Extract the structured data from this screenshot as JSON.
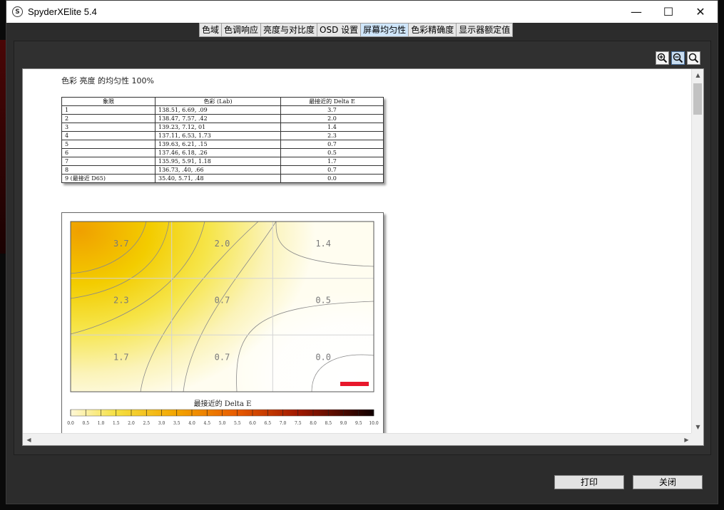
{
  "window": {
    "title": "SpyderXElite 5.4",
    "logo_glyph": "S",
    "minimize_glyph": "—",
    "maximize_glyph": "☐",
    "close_glyph": "✕"
  },
  "tabs": [
    {
      "label": "色域",
      "active": false
    },
    {
      "label": "色调响应",
      "active": false
    },
    {
      "label": "亮度与对比度",
      "active": false
    },
    {
      "label": "OSD 设置",
      "active": false
    },
    {
      "label": "屏幕均匀性",
      "active": true
    },
    {
      "label": "色彩精确度",
      "active": false
    },
    {
      "label": "显示器额定值",
      "active": false
    }
  ],
  "zoom_icons": [
    "zoom-in-icon",
    "zoom-out-icon",
    "zoom-fit-icon"
  ],
  "report": {
    "title": "色彩 亮度 的均匀性 100%",
    "table": {
      "headers": [
        "象限",
        "色彩 (Lab)",
        "最接近的 Delta E"
      ],
      "rows": [
        {
          "quadrant": "1",
          "lab": "138.51,    6.69,    .09",
          "de": "3.7"
        },
        {
          "quadrant": "2",
          "lab": "138.47,    7.57,    .42",
          "de": "2.0"
        },
        {
          "quadrant": "3",
          "lab": "139.23,    7.12,     01",
          "de": "1.4"
        },
        {
          "quadrant": "4",
          "lab": "137.11,    6.53,   1.73",
          "de": "2.3"
        },
        {
          "quadrant": "5",
          "lab": "139.63,    6.21,    .15",
          "de": "0.7"
        },
        {
          "quadrant": "6",
          "lab": "137.46,    6.18,    .26",
          "de": "0.5"
        },
        {
          "quadrant": "7",
          "lab": "135.95,    5.91,   1.18",
          "de": "1.7"
        },
        {
          "quadrant": "8",
          "lab": "136.73,     .40,    .66",
          "de": "0.7"
        },
        {
          "quadrant": "9 (最接近 D65)",
          "lab": "35.40,    5.71,    .48",
          "de": "0.0"
        }
      ]
    },
    "heatmap": {
      "cell_labels": [
        [
          "3.7",
          "2.0",
          "1.4"
        ],
        [
          "2.3",
          "0.7",
          "0.5"
        ],
        [
          "1.7",
          "0.7",
          "0.0"
        ]
      ],
      "legend_title": "最接近的 Delta E",
      "scale_ticks": [
        "0.0",
        "0.5",
        "1.0",
        "1.5",
        "2.0",
        "2.5",
        "3.0",
        "3.5",
        "4.0",
        "4.5",
        "5.0",
        "5.5",
        "6.0",
        "6.5",
        "7.0",
        "7.5",
        "8.0",
        "8.5",
        "9.0",
        "9.5",
        "10.0"
      ],
      "colors": {
        "low": "#fff6cc",
        "mid": "#f2d400",
        "high": "#f0a300",
        "max": "#1a0000",
        "marker": "#e8172b"
      }
    }
  },
  "buttons": {
    "print": "打印",
    "close": "关闭"
  },
  "chart_data": {
    "type": "heatmap",
    "grid": [
      [
        3.7,
        2.0,
        1.4
      ],
      [
        2.3,
        0.7,
        0.5
      ],
      [
        1.7,
        0.7,
        0.0
      ]
    ],
    "colorbar_range": [
      0,
      10
    ],
    "colorbar_label": "最接近的 Delta E"
  }
}
